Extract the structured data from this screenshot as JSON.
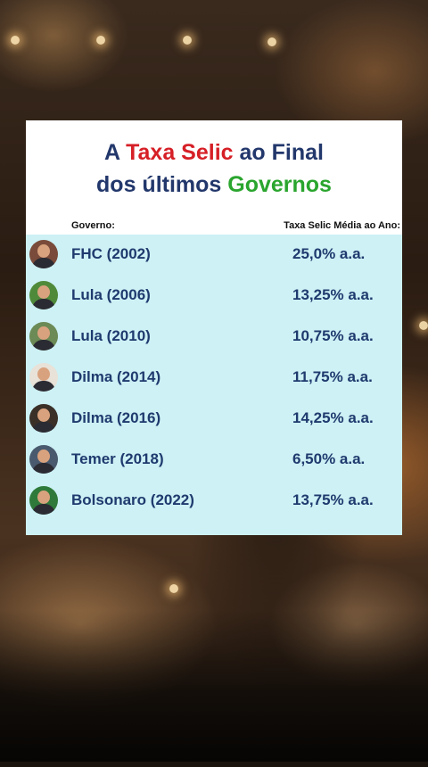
{
  "title": {
    "line1_part1": "A ",
    "line1_red": "Taxa Selic",
    "line1_part2": " ao Final",
    "line2_part1": "dos últimos ",
    "line2_green": "Governos"
  },
  "header": {
    "left": "Governo:",
    "right": "Taxa Selic Média ao Ano:"
  },
  "rows": [
    {
      "governo": "FHC (2002)",
      "taxa": "25,0% a.a.",
      "avatar_bg": "#7a4b3a"
    },
    {
      "governo": "Lula (2006)",
      "taxa": "13,25% a.a.",
      "avatar_bg": "#4f8a3a"
    },
    {
      "governo": "Lula (2010)",
      "taxa": "10,75% a.a.",
      "avatar_bg": "#6b8a55"
    },
    {
      "governo": "Dilma (2014)",
      "taxa": "11,75% a.a.",
      "avatar_bg": "#e8e2d8"
    },
    {
      "governo": "Dilma (2016)",
      "taxa": "14,25% a.a.",
      "avatar_bg": "#3a3028"
    },
    {
      "governo": "Temer (2018)",
      "taxa": "6,50% a.a.",
      "avatar_bg": "#4a5a6e"
    },
    {
      "governo": "Bolsonaro (2022)",
      "taxa": "13,75% a.a.",
      "avatar_bg": "#2f7a3a"
    }
  ],
  "colors": {
    "title_blue": "#22376b",
    "title_red": "#d61f26",
    "title_green": "#2aa52e",
    "table_bg": "#cdf1f5",
    "row_text": "#1f3a6e"
  }
}
